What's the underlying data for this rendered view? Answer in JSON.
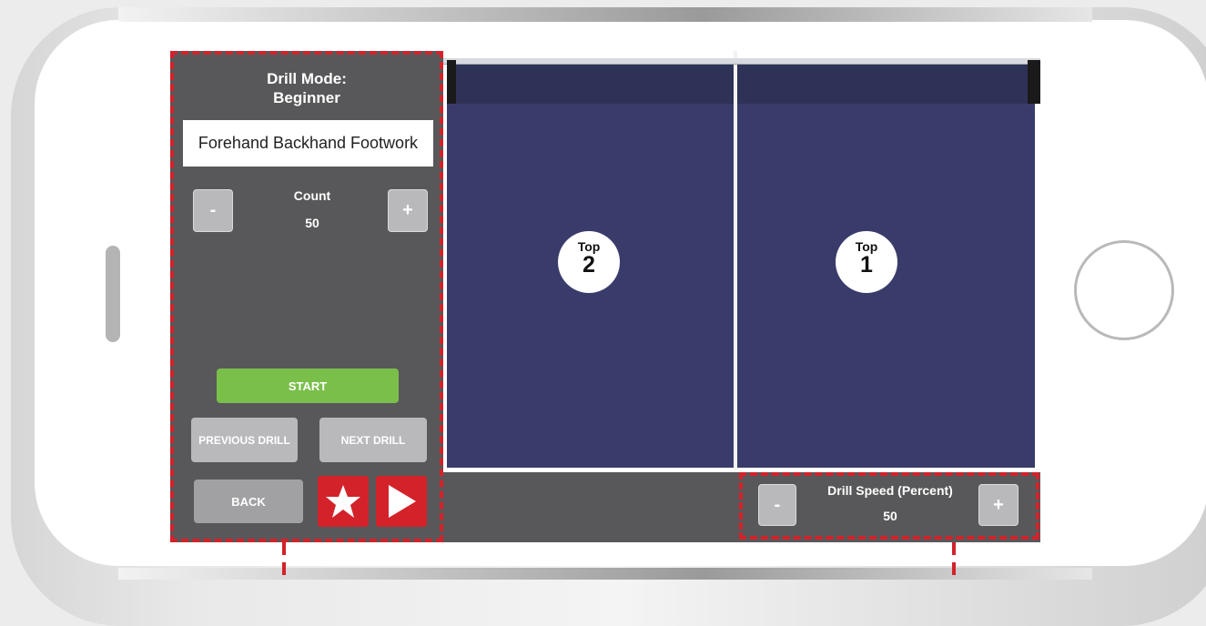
{
  "drill_panel": {
    "title_line1": "Drill Mode:",
    "title_line2": "Beginner",
    "drill_name": "Forehand Backhand Footwork",
    "count": {
      "label": "Count",
      "value": "50",
      "decrease": "-",
      "increase": "+"
    },
    "start_label": "START",
    "previous_label": "PREVIOUS DRILL",
    "next_label": "NEXT DRILL",
    "back_label": "BACK",
    "favorite_icon": "star-icon",
    "play_icon": "play-icon"
  },
  "table": {
    "markers": [
      {
        "label": "Top",
        "number": "2"
      },
      {
        "label": "Top",
        "number": "1"
      }
    ]
  },
  "drill_speed": {
    "label": "Drill Speed (Percent)",
    "value": "50",
    "decrease": "-",
    "increase": "+"
  },
  "colors": {
    "panel_bg": "#58585a",
    "accent_red": "#d3222a",
    "start_green": "#7bbf4b",
    "table_blue": "#393c6a",
    "button_grey": "#b9b9bb"
  }
}
